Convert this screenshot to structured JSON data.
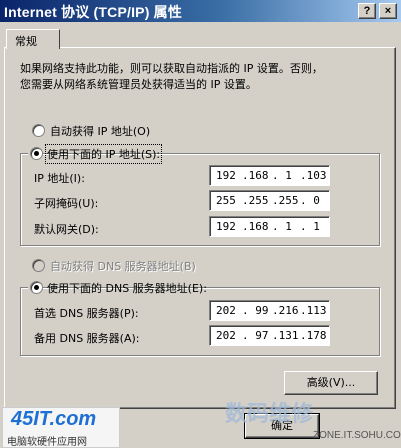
{
  "window": {
    "title": "Internet 协议 (TCP/IP) 属性",
    "help_btn": "?",
    "close_btn": "×"
  },
  "tab": {
    "label": "常规"
  },
  "description": "如果网络支持此功能，则可以获取自动指派的 IP 设置。否则，\n您需要从网络系统管理员处获得适当的 IP 设置。",
  "ip": {
    "auto_label": "自动获得 IP 地址(O)",
    "manual_label": "使用下面的 IP 地址(S):",
    "mode": "manual",
    "fields": [
      {
        "label": "IP 地址(I):",
        "octets": [
          "192",
          ".168",
          ".  1",
          ".103"
        ]
      },
      {
        "label": "子网掩码(U):",
        "octets": [
          "255",
          ".255",
          ".255",
          ".  0"
        ]
      },
      {
        "label": "默认网关(D):",
        "octets": [
          "192",
          ".168",
          ".  1",
          ".  1"
        ]
      }
    ]
  },
  "dns": {
    "auto_label": "自动获得 DNS 服务器地址(B)",
    "manual_label": "使用下面的 DNS 服务器地址(E):",
    "fields": [
      {
        "label": "首选 DNS 服务器(P):",
        "octets": [
          "202",
          ". 99",
          ".216",
          ".113"
        ]
      },
      {
        "label": "备用 DNS 服务器(A):",
        "octets": [
          "202",
          ". 97",
          ".131",
          ".178"
        ]
      }
    ]
  },
  "buttons": {
    "advanced": "高级(V)...",
    "ok": "确定"
  },
  "watermark": {
    "logo": "45IT.com",
    "logo_sub": "电脑软硬件应用网",
    "center": "数码维修",
    "url": "ZONE.IT.SOHU.COM"
  }
}
